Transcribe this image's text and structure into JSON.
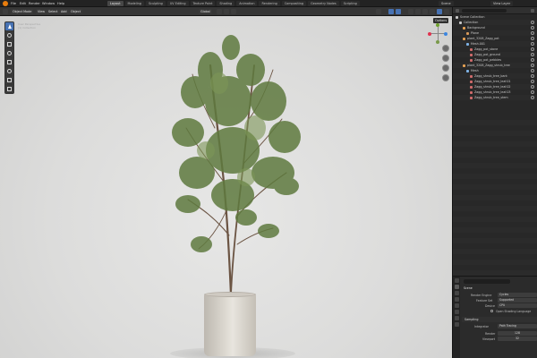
{
  "topbar": {
    "menus": [
      "File",
      "Edit",
      "Render",
      "Window",
      "Help"
    ],
    "workspaces": [
      "Layout",
      "Modeling",
      "Sculpting",
      "UV Editing",
      "Texture Paint",
      "Shading",
      "Animation",
      "Rendering",
      "Compositing",
      "Geometry Nodes",
      "Scripting"
    ],
    "active_workspace": "Layout",
    "scene_name": "Scene",
    "view_layer": "View Layer"
  },
  "viewport": {
    "mode": "Object Mode",
    "header_buttons": [
      "View",
      "Select",
      "Add",
      "Object"
    ],
    "transform": "Global",
    "options_label": "Options",
    "view_info": [
      "User Perspective",
      "(1) Collection"
    ]
  },
  "outliner": {
    "title": "Scene Collection",
    "rows": [
      {
        "label": "Scene Collection",
        "indent": 0,
        "color": "#c8c8c8"
      },
      {
        "label": "Collection",
        "indent": 1,
        "color": "#c8c8c8"
      },
      {
        "label": "Background",
        "indent": 2,
        "color": "#e6a153"
      },
      {
        "label": "Plane",
        "indent": 3,
        "color": "#d89a5a"
      },
      {
        "label": "plant_3208_Zagg_pot",
        "indent": 2,
        "color": "#e6a153"
      },
      {
        "label": "Mesh.001",
        "indent": 3,
        "color": "#7fb3e6"
      },
      {
        "label": "Zagg_pot_stone",
        "indent": 4,
        "color": "#d06b6b"
      },
      {
        "label": "Zagg_pot_ground",
        "indent": 4,
        "color": "#d06b6b"
      },
      {
        "label": "Zagg_pot_pebbles",
        "indent": 4,
        "color": "#d06b6b"
      },
      {
        "label": "plant_3208_Zagg_shrub_tree",
        "indent": 2,
        "color": "#e6a153"
      },
      {
        "label": "Mesh",
        "indent": 3,
        "color": "#7fb3e6"
      },
      {
        "label": "Zagg_shrub_tree_bark",
        "indent": 4,
        "color": "#d06b6b"
      },
      {
        "label": "Zagg_shrub_tree_leaf.01",
        "indent": 4,
        "color": "#d06b6b"
      },
      {
        "label": "Zagg_shrub_tree_leaf.02",
        "indent": 4,
        "color": "#d06b6b"
      },
      {
        "label": "Zagg_shrub_tree_leaf.03",
        "indent": 4,
        "color": "#d06b6b"
      },
      {
        "label": "Zagg_shrub_tree_stem",
        "indent": 4,
        "color": "#d06b6b"
      }
    ]
  },
  "properties": {
    "panel_title": "Scene",
    "render_engine_label": "Render Engine",
    "render_engine": "Cycles",
    "feature_set_label": "Feature Set",
    "feature_set": "Supported",
    "device_label": "Device",
    "device": "CPU",
    "osl_label": "Open Shading Language",
    "sampling_section": "Sampling",
    "integrator_label": "Integrator",
    "integrator": "Path Tracing",
    "render_label": "Render",
    "render_samples": "128",
    "viewport_label": "Viewport",
    "viewport_samples": "32"
  },
  "colors": {
    "accent": "#4772b3",
    "blender_orange": "#e87d0d",
    "foliage": "#5f7a3f",
    "trunk": "#6b5443",
    "pot": "#d9d5cd"
  }
}
